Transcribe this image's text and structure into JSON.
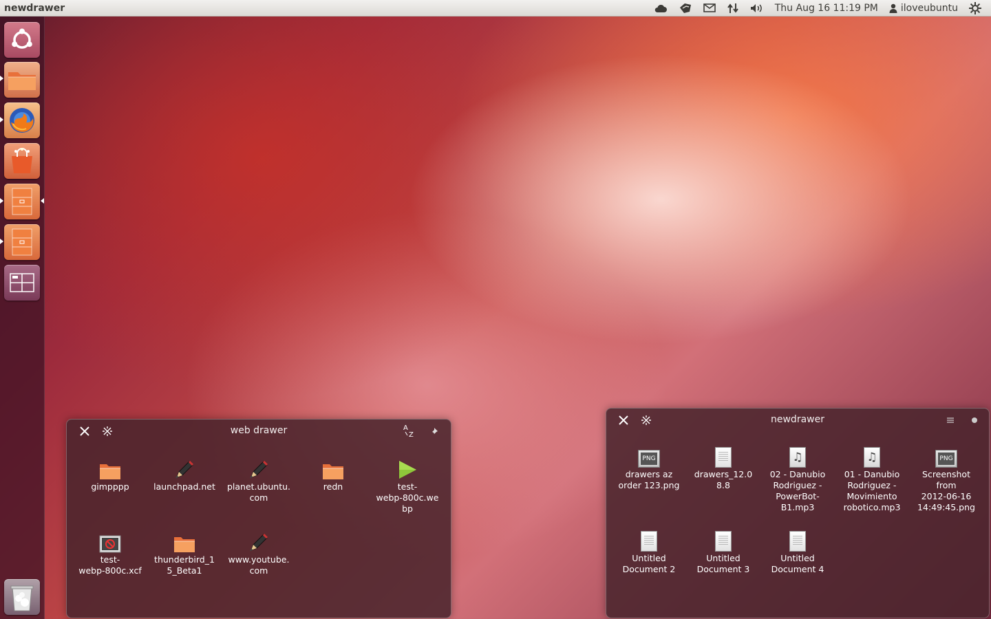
{
  "panel": {
    "app_title": "newdrawer",
    "datetime": "Thu Aug 16 11:19 PM",
    "user": "iloveubuntu",
    "icons": [
      "cloud-icon",
      "messaging-icon",
      "mail-icon",
      "network-icon",
      "volume-icon",
      "user-icon",
      "session-gear-icon"
    ]
  },
  "launcher": {
    "items": [
      {
        "name": "dash-home",
        "icon": "ubuntu-logo-icon"
      },
      {
        "name": "files",
        "icon": "folder-icon"
      },
      {
        "name": "firefox",
        "icon": "firefox-icon"
      },
      {
        "name": "software-center",
        "icon": "shopping-bag-icon"
      },
      {
        "name": "drawer-1",
        "icon": "drawer-icon"
      },
      {
        "name": "drawer-2",
        "icon": "drawer-icon"
      },
      {
        "name": "workspace-switcher",
        "icon": "workspaces-icon"
      },
      {
        "name": "trash",
        "icon": "trash-icon"
      }
    ]
  },
  "web_drawer": {
    "title": "web drawer",
    "items": [
      {
        "label": "gimpppp",
        "icon": "folder-icon"
      },
      {
        "label": "launchpad.net",
        "icon": "pencil-icon"
      },
      {
        "label": "planet.ubuntu.\ncom",
        "icon": "pencil-icon"
      },
      {
        "label": "redn",
        "icon": "folder-icon"
      },
      {
        "label": "test-\nwebp-800c.we\nbp",
        "icon": "play-icon"
      },
      {
        "label": "test-\nwebp-800c.xcf",
        "icon": "xcf-icon"
      },
      {
        "label": "thunderbird_1\n5_Beta1",
        "icon": "folder-icon"
      },
      {
        "label": "www.youtube.\ncom",
        "icon": "pencil-icon"
      }
    ]
  },
  "newdrawer": {
    "title": "newdrawer",
    "png_text": "PNG",
    "items": [
      {
        "label": "drawers az\norder 123.png",
        "icon": "png-icon"
      },
      {
        "label": "drawers_12.0\n8.8",
        "icon": "document-icon"
      },
      {
        "label": "02 - Danubio\nRodriguez -\nPowerBot-\nB1.mp3",
        "icon": "mp3-icon"
      },
      {
        "label": "01 - Danubio\nRodriguez -\nMovimiento\nrobotico.mp3",
        "icon": "mp3-icon"
      },
      {
        "label": "Screenshot\nfrom\n2012-06-16\n14:49:45.png",
        "icon": "png-icon"
      },
      {
        "label": "Untitled\nDocument 2",
        "icon": "document-icon"
      },
      {
        "label": "Untitled\nDocument 3",
        "icon": "document-icon"
      },
      {
        "label": "Untitled\nDocument 4",
        "icon": "document-icon"
      }
    ]
  }
}
